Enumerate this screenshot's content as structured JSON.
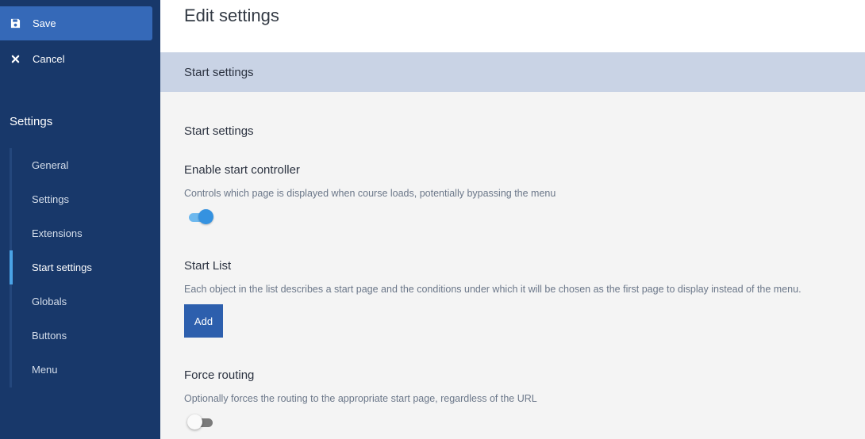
{
  "sidebar": {
    "save_label": "Save",
    "cancel_label": "Cancel",
    "title": "Settings",
    "items": [
      {
        "label": "General"
      },
      {
        "label": "Settings"
      },
      {
        "label": "Extensions"
      },
      {
        "label": "Start settings",
        "active": true
      },
      {
        "label": "Globals"
      },
      {
        "label": "Buttons"
      },
      {
        "label": "Menu"
      }
    ]
  },
  "header": {
    "title": "Edit settings"
  },
  "section": {
    "title": "Start settings"
  },
  "form": {
    "heading": "Start settings",
    "enable_start": {
      "label": "Enable start controller",
      "description": "Controls which page is displayed when course loads, potentially bypassing the menu",
      "value": true
    },
    "start_list": {
      "label": "Start List",
      "description": "Each object in the list describes a start page and the conditions under which it will be chosen as the first page to display instead of the menu.",
      "add_label": "Add"
    },
    "force_routing": {
      "label": "Force routing",
      "description": "Optionally forces the routing to the appropriate start page, regardless of the URL",
      "value": false
    }
  },
  "colors": {
    "sidebar_bg": "#18386a",
    "save_bg": "#3569b8",
    "active_indicator": "#4aa3e6",
    "section_bar": "#c9d3e5",
    "toggle_on": "#3592e0",
    "add_button": "#2d5fad"
  }
}
